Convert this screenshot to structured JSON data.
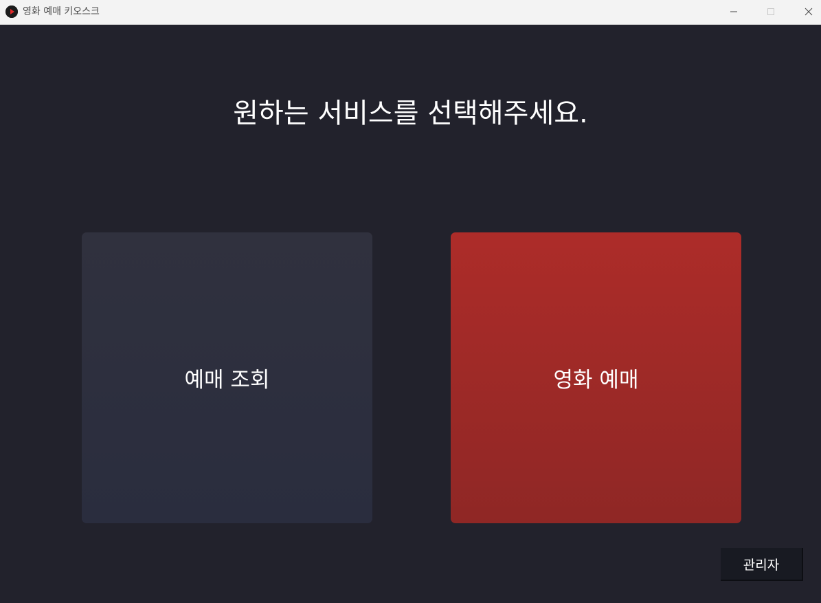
{
  "window": {
    "title": "영화 예매 키오스크",
    "controls": {
      "minimize_icon": "minimize-icon",
      "maximize_icon": "maximize-icon",
      "close_icon": "close-icon"
    }
  },
  "main": {
    "heading": "원하는 서비스를 선택해주세요.",
    "tiles": [
      {
        "label": "예매 조회",
        "color": "#2d2f3e"
      },
      {
        "label": "영화 예매",
        "color": "#a32a27"
      }
    ],
    "admin_button": "관리자"
  },
  "colors": {
    "background": "#22222c",
    "titlebar": "#f3f3f3",
    "admin_button_bg": "#181a22",
    "text": "#ffffff"
  }
}
